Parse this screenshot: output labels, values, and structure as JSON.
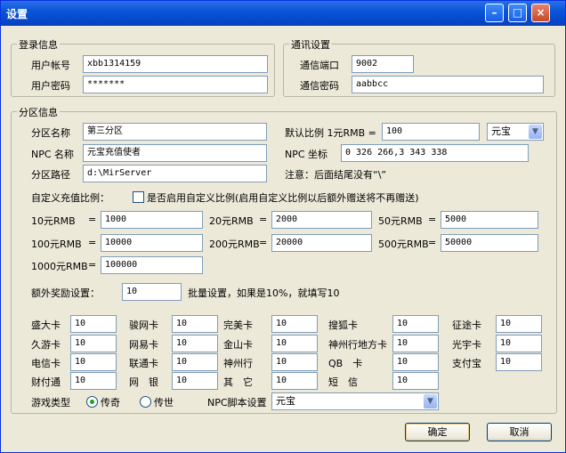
{
  "window": {
    "title": "设置",
    "minimize_icon": "minimize-icon",
    "maximize_icon": "maximize-icon",
    "close_icon": "close-icon"
  },
  "login": {
    "legend": "登录信息",
    "account_label": "用户帐号",
    "account_value": "xbb1314159",
    "password_label": "用户密码",
    "password_value": "*******"
  },
  "comm": {
    "legend": "通讯设置",
    "port_label": "通信端口",
    "port_value": "9002",
    "password_label": "通信密码",
    "password_value": "aabbcc"
  },
  "zone": {
    "legend": "分区信息",
    "name_label": "分区名称",
    "name_value": "第三分区",
    "npc_name_label": "NPC 名称",
    "npc_name_value": "元宝充值使者",
    "path_label": "分区路径",
    "path_value": "d:\\MirServer",
    "ratio_label": "默认比例 1元RMB =",
    "ratio_value": "100",
    "currency_selected": "元宝",
    "npc_coord_label": "NPC 坐标",
    "npc_coord_value": "0 326 266,3 343 338",
    "note": "注意：后面结尾没有“\\”",
    "custom_ratio_label": "自定义充值比例：",
    "custom_ratio_checkbox_label": "是否启用自定义比例(启用自定义比例以后额外赠送将不再赠送)",
    "rmb_rows": [
      {
        "label": "10元RMB",
        "eq": "=",
        "value": "1000"
      },
      {
        "label": "20元RMB",
        "eq": "=",
        "value": "2000"
      },
      {
        "label": "50元RMB",
        "eq": "=",
        "value": "5000"
      },
      {
        "label": "100元RMB",
        "eq": "=",
        "value": "10000"
      },
      {
        "label": "200元RMB",
        "eq": "=",
        "value": "20000"
      },
      {
        "label": "500元RMB",
        "eq": "=",
        "value": "50000"
      },
      {
        "label": "1000元RMB",
        "eq": "=",
        "value": "100000"
      }
    ],
    "bonus_label": "额外奖励设置：",
    "bonus_value": "10",
    "bonus_hint": "批量设置，如果是10%，就填写10",
    "cards": [
      {
        "label": "盛大卡",
        "value": "10"
      },
      {
        "label": "骏网卡",
        "value": "10"
      },
      {
        "label": "完美卡",
        "value": "10"
      },
      {
        "label": "搜狐卡",
        "value": "10"
      },
      {
        "label": "征途卡",
        "value": "10"
      },
      {
        "label": "久游卡",
        "value": "10"
      },
      {
        "label": "网易卡",
        "value": "10"
      },
      {
        "label": "金山卡",
        "value": "10"
      },
      {
        "label": "神州行地方卡",
        "value": "10"
      },
      {
        "label": "光宇卡",
        "value": "10"
      },
      {
        "label": "电信卡",
        "value": "10"
      },
      {
        "label": "联通卡",
        "value": "10"
      },
      {
        "label": "神州行",
        "value": "10"
      },
      {
        "label": "QB　卡",
        "value": "10"
      },
      {
        "label": "支付宝",
        "value": "10"
      },
      {
        "label": "财付通",
        "value": "10"
      },
      {
        "label": "网　银",
        "value": "10"
      },
      {
        "label": "其　它",
        "value": "10"
      },
      {
        "label": "短　信",
        "value": "10"
      }
    ],
    "game_type_label": "游戏类型",
    "game_types": [
      {
        "label": "传奇",
        "selected": true
      },
      {
        "label": "传世",
        "selected": false
      }
    ],
    "npc_script_label": "NPC脚本设置",
    "npc_script_value": "元宝"
  },
  "buttons": {
    "ok": "确定",
    "cancel": "取消"
  }
}
